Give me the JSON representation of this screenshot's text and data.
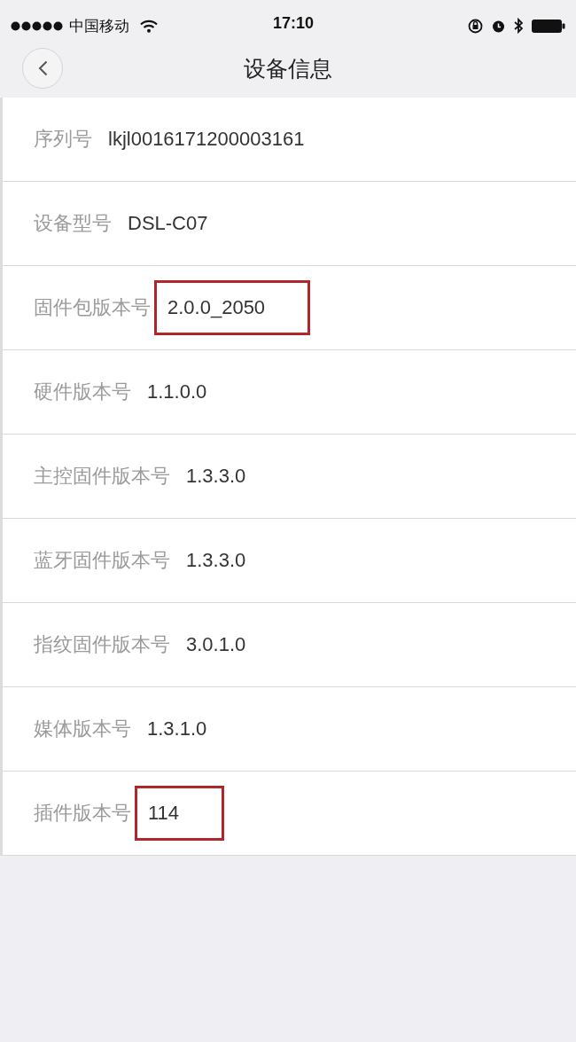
{
  "status_bar": {
    "carrier": "中国移动",
    "time": "17:10"
  },
  "nav": {
    "title": "设备信息"
  },
  "rows": [
    {
      "label": "序列号",
      "value": "lkjl0016171200003161",
      "highlighted": false
    },
    {
      "label": "设备型号",
      "value": "DSL-C07",
      "highlighted": false
    },
    {
      "label": "固件包版本号",
      "value": "2.0.0_2050",
      "highlighted": true
    },
    {
      "label": "硬件版本号",
      "value": "1.1.0.0",
      "highlighted": false
    },
    {
      "label": "主控固件版本号",
      "value": "1.3.3.0",
      "highlighted": false
    },
    {
      "label": "蓝牙固件版本号",
      "value": "1.3.3.0",
      "highlighted": false
    },
    {
      "label": "指纹固件版本号",
      "value": "3.0.1.0",
      "highlighted": false
    },
    {
      "label": "媒体版本号",
      "value": "1.3.1.0",
      "highlighted": false
    },
    {
      "label": "插件版本号",
      "value": "114",
      "highlighted": true
    }
  ]
}
